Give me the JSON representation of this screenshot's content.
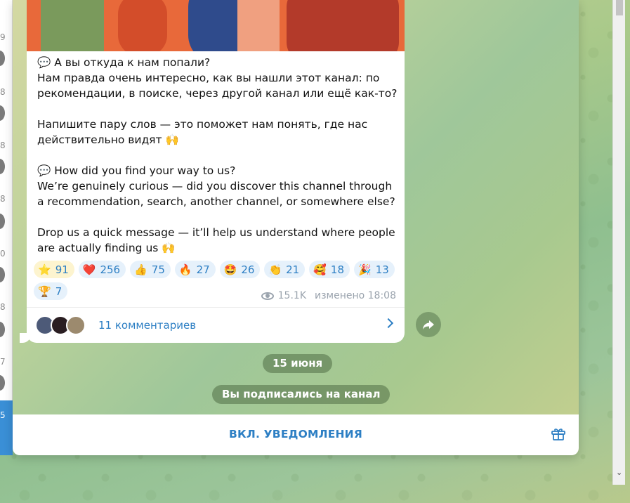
{
  "left_list": {
    "visible_numbers": [
      "9",
      "8",
      "8",
      "8",
      "0",
      "8",
      "7",
      "5"
    ]
  },
  "message": {
    "paragraphs": [
      "💬 А вы откуда к нам попали?",
      "Нам правда очень интересно, как вы нашли этот канал: по рекомендации, в поиске, через другой канал или ещё как-то?",
      "",
      "Напишите пару слов — это поможет нам понять, где нас действительно видят 🙌",
      "",
      "💬 How did you find your way to us?",
      "We’re genuinely curious — did you discover this channel through a recommendation, search, another channel, or somewhere else?",
      "",
      "Drop us a quick message — it’ll help us understand where people are actually finding us 🙌"
    ],
    "reactions": [
      {
        "emoji": "⭐",
        "count": "91",
        "selected": true
      },
      {
        "emoji": "❤️",
        "count": "256"
      },
      {
        "emoji": "👍",
        "count": "75"
      },
      {
        "emoji": "🔥",
        "count": "27"
      },
      {
        "emoji": "🤩",
        "count": "26"
      },
      {
        "emoji": "👏",
        "count": "21"
      },
      {
        "emoji": "🥰",
        "count": "18"
      },
      {
        "emoji": "🎉",
        "count": "13"
      },
      {
        "emoji": "🏆",
        "count": "7"
      }
    ],
    "views": "15.1K",
    "edited_label": "изменено 18:08",
    "comments_label": "11 комментариев"
  },
  "service": {
    "date": "15 июня",
    "subscribed": "Вы подписались на канал"
  },
  "bottom": {
    "notifications_button": "ВКЛ. УВЕДОМЛЕНИЯ"
  },
  "colors": {
    "accent": "#2d7fc4",
    "reaction_bg": "#e6f1fb",
    "selected_reaction_bg": "#fdf4cf"
  }
}
